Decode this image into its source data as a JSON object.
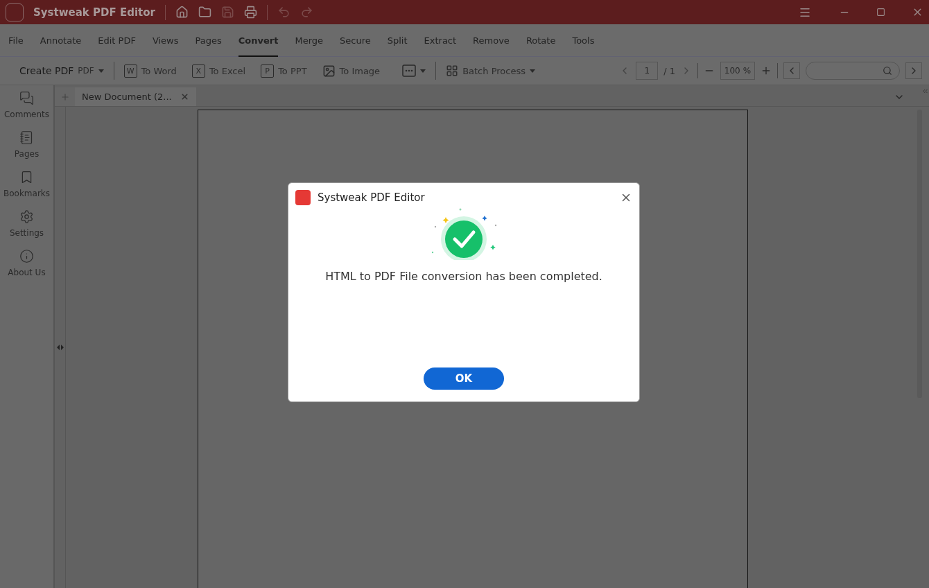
{
  "window": {
    "title": "Systweak PDF Editor"
  },
  "menu": [
    {
      "label": "File",
      "selected": false
    },
    {
      "label": "Annotate",
      "selected": false
    },
    {
      "label": "Edit PDF",
      "selected": false
    },
    {
      "label": "Views",
      "selected": false
    },
    {
      "label": "Pages",
      "selected": false
    },
    {
      "label": "Convert",
      "selected": true
    },
    {
      "label": "Merge",
      "selected": false
    },
    {
      "label": "Secure",
      "selected": false
    },
    {
      "label": "Split",
      "selected": false
    },
    {
      "label": "Extract",
      "selected": false
    },
    {
      "label": "Remove",
      "selected": false
    },
    {
      "label": "Rotate",
      "selected": false
    },
    {
      "label": "Tools",
      "selected": false
    }
  ],
  "toolbar": {
    "create_label": "Create PDF",
    "create_suffix": "PDF",
    "items": [
      {
        "kind": "letter",
        "badge": "W",
        "label": "To Word"
      },
      {
        "kind": "letter",
        "badge": "X",
        "label": "To Excel"
      },
      {
        "kind": "letter",
        "badge": "P",
        "label": "To PPT"
      },
      {
        "kind": "image",
        "label": "To Image"
      }
    ],
    "batch_label": "Batch Process",
    "page_current": "1",
    "page_total": "/ 1",
    "zoom": "100",
    "zoom_unit": "%"
  },
  "sidebar": {
    "items": [
      {
        "kind": "comments",
        "label": "Comments"
      },
      {
        "kind": "pages",
        "label": "Pages"
      },
      {
        "kind": "bookmarks",
        "label": "Bookmarks"
      },
      {
        "kind": "settings",
        "label": "Settings"
      },
      {
        "kind": "about",
        "label": "About Us"
      }
    ]
  },
  "tabs": [
    {
      "label": "New Document (2...",
      "selected": true
    }
  ],
  "dialog": {
    "title": "Systweak PDF Editor",
    "message": "HTML to PDF File conversion has been completed.",
    "button": "OK"
  }
}
